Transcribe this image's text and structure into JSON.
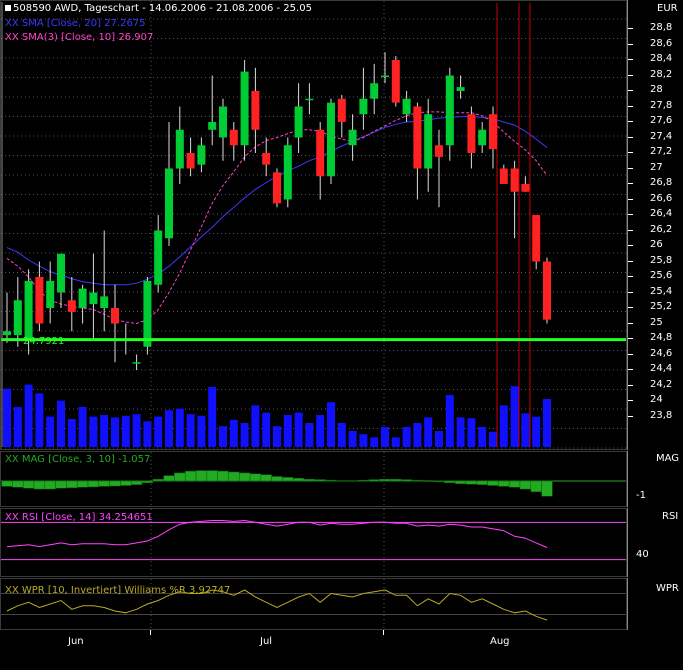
{
  "header": {
    "symbol": "508590",
    "title": "AWD, Tageschart - 14.06.2006 - 21.08.2006 - 25.05",
    "indicator1": "XX SMA [Close, 20] 27.2675",
    "indicator2": "XX SMA(3) [Close, 10] 26.907",
    "line_label": "24.7921",
    "currency": "EUR"
  },
  "colors": {
    "up": "#00cc33",
    "down": "#ff2222",
    "volume": "#1010ff",
    "sma20": "#3a3aff",
    "sma10": "#ff44cc",
    "hline": "#22ff22",
    "vline": "#cc0000",
    "mag": "#22aa22",
    "rsi": "#ff44ff",
    "wpr": "#bbaa22"
  },
  "chart_data": [
    {
      "type": "candlestick",
      "title": "508590 AWD, Tageschart - 14.06.2006 - 21.08.2006 - 25.05",
      "ylabel": "EUR",
      "ylim": [
        23.6,
        29.1
      ],
      "y_ticks": [
        "28,8",
        "28,6",
        "28,4",
        "28,2",
        "28",
        "27,8",
        "27,6",
        "27,4",
        "27,2",
        "27",
        "26,8",
        "26,6",
        "26,4",
        "26,2",
        "26",
        "25,8",
        "25,6",
        "25,4",
        "25,2",
        "25",
        "24,8",
        "24,6",
        "24,4",
        "24,2",
        "24",
        "23,8"
      ],
      "x_ticks": [
        "Jun",
        "Jul",
        "Aug"
      ],
      "candles": [
        {
          "o": 24.85,
          "h": 25.4,
          "l": 24.75,
          "c": 24.9
        },
        {
          "o": 24.85,
          "h": 25.6,
          "l": 24.7,
          "c": 25.3
        },
        {
          "o": 24.8,
          "h": 25.7,
          "l": 24.6,
          "c": 25.55
        },
        {
          "o": 25.6,
          "h": 25.8,
          "l": 24.9,
          "c": 25.0
        },
        {
          "o": 25.2,
          "h": 25.8,
          "l": 25.0,
          "c": 25.55
        },
        {
          "o": 25.4,
          "h": 25.9,
          "l": 25.2,
          "c": 25.9
        },
        {
          "o": 25.3,
          "h": 25.6,
          "l": 24.9,
          "c": 25.15
        },
        {
          "o": 25.2,
          "h": 25.5,
          "l": 25.0,
          "c": 25.45
        },
        {
          "o": 25.25,
          "h": 25.9,
          "l": 24.8,
          "c": 25.4
        },
        {
          "o": 25.2,
          "h": 26.2,
          "l": 24.9,
          "c": 25.35
        },
        {
          "o": 25.2,
          "h": 25.5,
          "l": 24.5,
          "c": 25.0
        },
        {
          "o": 24.8,
          "h": 25.0,
          "l": 24.6,
          "c": 24.8
        },
        {
          "o": 24.5,
          "h": 24.6,
          "l": 24.4,
          "c": 24.5
        },
        {
          "o": 24.7,
          "h": 25.6,
          "l": 24.6,
          "c": 25.55
        },
        {
          "o": 25.5,
          "h": 26.4,
          "l": 25.4,
          "c": 26.2
        },
        {
          "o": 26.1,
          "h": 27.6,
          "l": 26.0,
          "c": 27.0
        },
        {
          "o": 27.0,
          "h": 27.8,
          "l": 26.8,
          "c": 27.5
        },
        {
          "o": 27.2,
          "h": 27.4,
          "l": 26.9,
          "c": 27.0
        },
        {
          "o": 27.05,
          "h": 27.4,
          "l": 26.95,
          "c": 27.3
        },
        {
          "o": 27.5,
          "h": 28.2,
          "l": 27.3,
          "c": 27.6
        },
        {
          "o": 27.4,
          "h": 27.9,
          "l": 27.1,
          "c": 27.8
        },
        {
          "o": 27.5,
          "h": 27.6,
          "l": 27.1,
          "c": 27.3
        },
        {
          "o": 27.3,
          "h": 28.4,
          "l": 27.1,
          "c": 28.25
        },
        {
          "o": 28.0,
          "h": 28.3,
          "l": 27.2,
          "c": 27.5
        },
        {
          "o": 27.2,
          "h": 27.4,
          "l": 26.9,
          "c": 27.05
        },
        {
          "o": 26.95,
          "h": 27.0,
          "l": 26.5,
          "c": 26.55
        },
        {
          "o": 26.6,
          "h": 27.4,
          "l": 26.5,
          "c": 27.3
        },
        {
          "o": 27.4,
          "h": 28.1,
          "l": 27.2,
          "c": 27.8
        },
        {
          "o": 27.9,
          "h": 28.1,
          "l": 27.7,
          "c": 27.9
        },
        {
          "o": 27.5,
          "h": 27.6,
          "l": 26.6,
          "c": 26.9
        },
        {
          "o": 26.9,
          "h": 27.9,
          "l": 26.8,
          "c": 27.85
        },
        {
          "o": 27.9,
          "h": 27.95,
          "l": 27.4,
          "c": 27.6
        },
        {
          "o": 27.3,
          "h": 27.7,
          "l": 27.1,
          "c": 27.5
        },
        {
          "o": 27.7,
          "h": 28.3,
          "l": 27.5,
          "c": 27.9
        },
        {
          "o": 27.9,
          "h": 28.35,
          "l": 27.7,
          "c": 28.1
        },
        {
          "o": 28.2,
          "h": 28.5,
          "l": 28.1,
          "c": 28.2
        },
        {
          "o": 28.4,
          "h": 28.45,
          "l": 27.8,
          "c": 27.85
        },
        {
          "o": 27.7,
          "h": 28.0,
          "l": 27.6,
          "c": 27.9
        },
        {
          "o": 27.8,
          "h": 27.85,
          "l": 26.6,
          "c": 27.0
        },
        {
          "o": 27.0,
          "h": 27.9,
          "l": 26.7,
          "c": 27.7
        },
        {
          "o": 27.3,
          "h": 27.5,
          "l": 26.5,
          "c": 27.15
        },
        {
          "o": 27.3,
          "h": 28.3,
          "l": 27.1,
          "c": 28.2
        },
        {
          "o": 28.0,
          "h": 28.2,
          "l": 27.9,
          "c": 28.05
        },
        {
          "o": 27.7,
          "h": 27.8,
          "l": 27.0,
          "c": 27.2
        },
        {
          "o": 27.3,
          "h": 27.6,
          "l": 27.2,
          "c": 27.5
        },
        {
          "o": 27.7,
          "h": 27.8,
          "l": 27.0,
          "c": 27.25
        },
        {
          "o": 27.0,
          "h": 27.05,
          "l": 26.8,
          "c": 26.8
        },
        {
          "o": 27.0,
          "h": 27.1,
          "l": 26.1,
          "c": 26.7
        },
        {
          "o": 26.8,
          "h": 26.9,
          "l": 26.7,
          "c": 26.7
        },
        {
          "o": 26.4,
          "h": 26.4,
          "l": 25.7,
          "c": 25.8
        },
        {
          "o": 25.8,
          "h": 25.85,
          "l": 25.0,
          "c": 25.05
        }
      ],
      "sma20": [
        25.98,
        25.92,
        25.82,
        25.74,
        25.67,
        25.62,
        25.58,
        25.54,
        25.52,
        25.5,
        25.5,
        25.5,
        25.52,
        25.57,
        25.64,
        25.74,
        25.86,
        25.99,
        26.12,
        26.24,
        26.38,
        26.5,
        26.62,
        26.73,
        26.82,
        26.9,
        26.97,
        27.03,
        27.1,
        27.15,
        27.22,
        27.29,
        27.35,
        27.41,
        27.47,
        27.53,
        27.57,
        27.6,
        27.61,
        27.63,
        27.65,
        27.66,
        27.67,
        27.67,
        27.66,
        27.64,
        27.6,
        27.56,
        27.48,
        27.38,
        27.27
      ],
      "sma10": [
        25.84,
        25.74,
        25.6,
        25.42,
        25.3,
        25.25,
        25.22,
        25.2,
        25.18,
        25.12,
        25.05,
        25.02,
        25.0,
        25.05,
        25.18,
        25.4,
        25.65,
        25.95,
        26.25,
        26.55,
        26.78,
        26.96,
        27.15,
        27.28,
        27.36,
        27.4,
        27.45,
        27.5,
        27.5,
        27.48,
        27.42,
        27.38,
        27.35,
        27.4,
        27.48,
        27.55,
        27.62,
        27.68,
        27.72,
        27.73,
        27.73,
        27.72,
        27.72,
        27.72,
        27.68,
        27.6,
        27.47,
        27.35,
        27.24,
        27.1,
        26.91
      ],
      "volume": [
        0.73,
        0.5,
        0.78,
        0.67,
        0.38,
        0.58,
        0.35,
        0.5,
        0.38,
        0.4,
        0.37,
        0.39,
        0.41,
        0.32,
        0.38,
        0.46,
        0.48,
        0.41,
        0.39,
        0.75,
        0.26,
        0.34,
        0.3,
        0.52,
        0.43,
        0.26,
        0.4,
        0.43,
        0.3,
        0.4,
        0.56,
        0.3,
        0.2,
        0.16,
        0.12,
        0.25,
        0.12,
        0.25,
        0.3,
        0.37,
        0.2,
        0.65,
        0.37,
        0.36,
        0.25,
        0.19,
        0.52,
        0.76,
        0.42,
        0.38,
        0.6
      ]
    },
    {
      "type": "bar",
      "title": "XX MAG [Close, 3, 10] -1.057",
      "ylabel": "MAG",
      "y_ticks": [
        "-1"
      ],
      "values": [
        -0.3,
        -0.35,
        -0.4,
        -0.45,
        -0.45,
        -0.4,
        -0.38,
        -0.35,
        -0.33,
        -0.3,
        -0.28,
        -0.25,
        -0.2,
        -0.1,
        0.1,
        0.3,
        0.45,
        0.55,
        0.58,
        0.58,
        0.55,
        0.5,
        0.45,
        0.4,
        0.35,
        0.25,
        0.2,
        0.15,
        0.1,
        0.08,
        0.05,
        0.03,
        0.03,
        0.05,
        0.08,
        0.1,
        0.1,
        0.08,
        0.05,
        0.0,
        -0.05,
        -0.1,
        -0.15,
        -0.18,
        -0.2,
        -0.25,
        -0.3,
        -0.35,
        -0.45,
        -0.6,
        -0.85
      ]
    },
    {
      "type": "line",
      "title": "XX RSI [Close, 14] 34.254651",
      "ylabel": "RSI",
      "y_ticks": [
        "40"
      ],
      "ylim": [
        20,
        80
      ],
      "values": [
        44,
        45,
        46,
        44,
        46,
        48,
        46,
        47,
        47,
        47,
        46,
        46,
        48,
        50,
        55,
        62,
        68,
        70,
        71,
        72,
        72,
        71,
        72,
        70,
        68,
        66,
        68,
        70,
        70,
        67,
        69,
        68,
        68,
        69,
        70,
        70,
        69,
        69,
        66,
        67,
        66,
        68,
        67,
        65,
        65,
        63,
        61,
        55,
        53,
        48,
        43
      ]
    },
    {
      "type": "line",
      "title": "XX WPR [10, Invertiert] Williams %R 3.92747",
      "ylabel": "WPR",
      "ylim": [
        -10,
        110
      ],
      "values": [
        30,
        45,
        55,
        40,
        50,
        60,
        35,
        45,
        45,
        40,
        30,
        25,
        35,
        50,
        60,
        75,
        85,
        80,
        80,
        90,
        85,
        75,
        90,
        70,
        55,
        40,
        55,
        70,
        80,
        55,
        80,
        75,
        70,
        80,
        85,
        90,
        75,
        75,
        45,
        65,
        50,
        80,
        75,
        55,
        65,
        50,
        35,
        25,
        30,
        15,
        4
      ]
    }
  ]
}
